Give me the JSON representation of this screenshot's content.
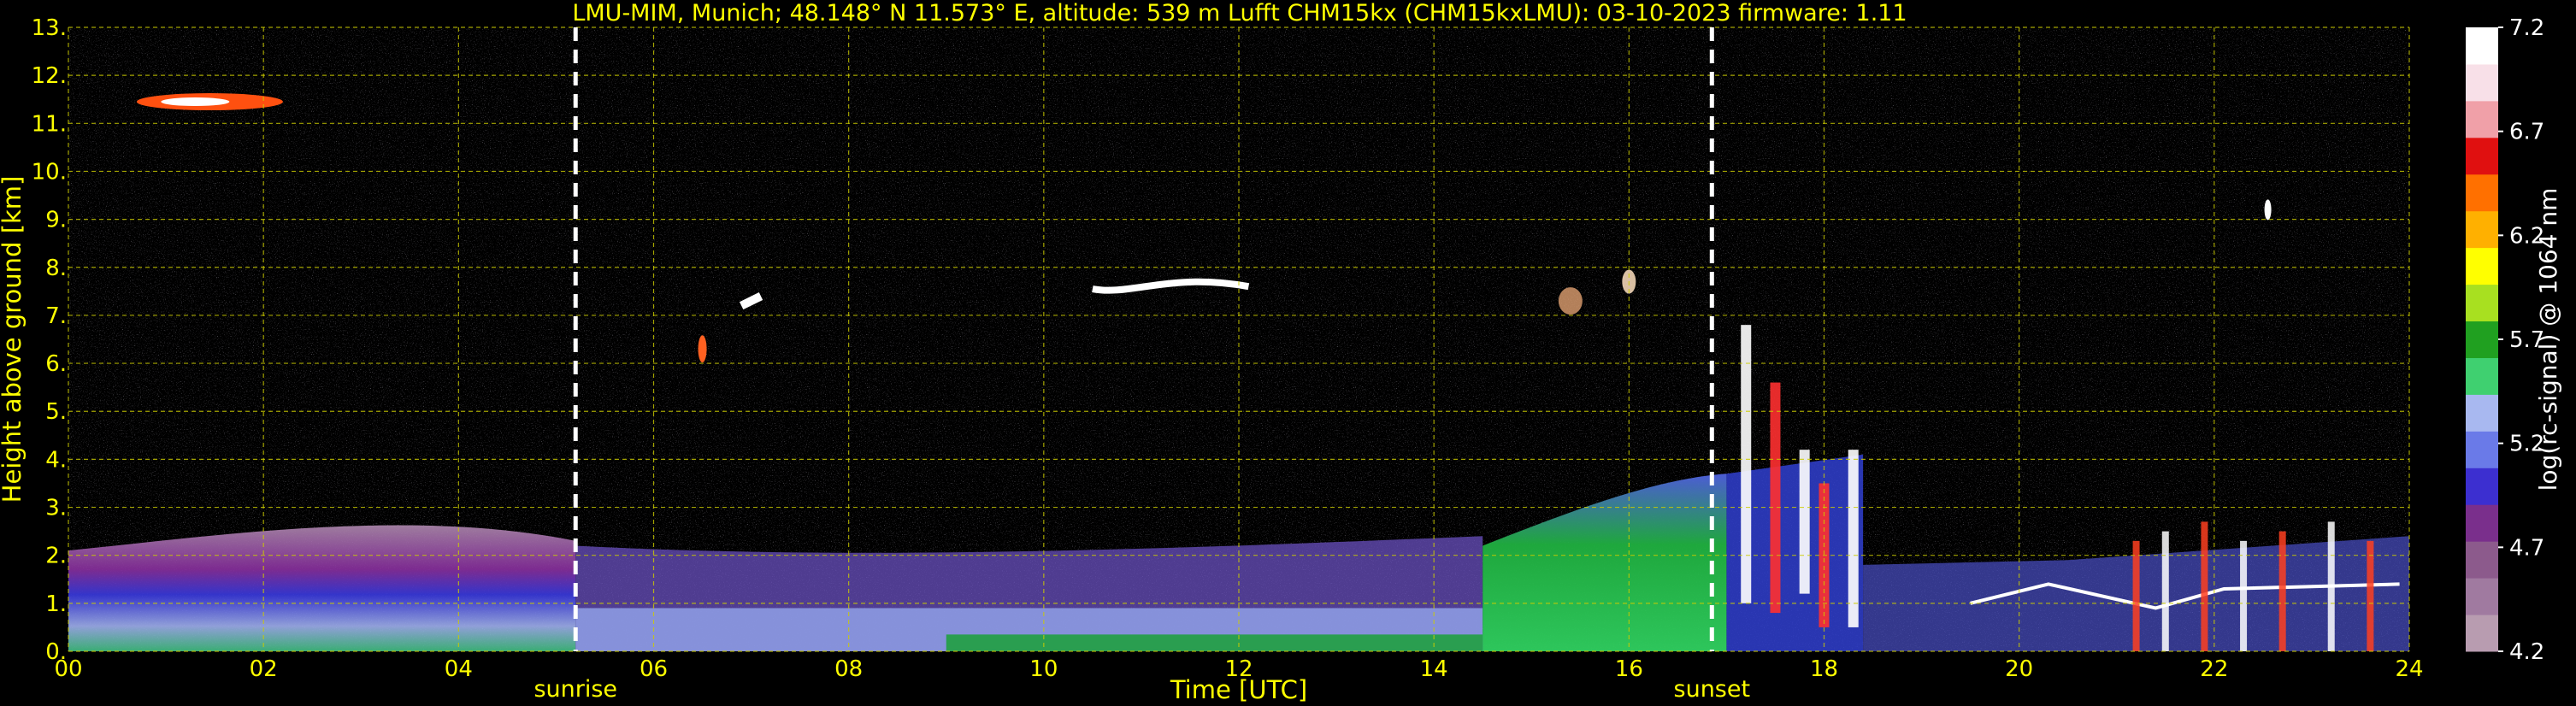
{
  "chart_data": {
    "type": "heatmap",
    "title": "LMU-MIM, Munich; 48.148° N 11.573° E, altitude: 539 m    Lufft CHM15kx (CHM15kxLMU): 03-10-2023    firmware: 1.11",
    "xlabel": "Time [UTC]",
    "ylabel": "Height above ground [km]",
    "xlim": [
      0,
      24
    ],
    "ylim": [
      0,
      13
    ],
    "x_ticks": [
      "00",
      "02",
      "04",
      "06",
      "08",
      "10",
      "12",
      "14",
      "16",
      "18",
      "20",
      "22",
      "24"
    ],
    "y_ticks": [
      "0.",
      "1.",
      "2.",
      "3.",
      "4.",
      "5.",
      "6.",
      "7.",
      "8.",
      "9.",
      "10.",
      "11.",
      "12.",
      "13."
    ],
    "grid": true,
    "events": [
      {
        "label": "sunrise",
        "time": 5.2
      },
      {
        "label": "sunset",
        "time": 16.85
      }
    ],
    "colorbar": {
      "label": "log(rc-signal) @ 1064 nm",
      "range": [
        4.2,
        7.2
      ],
      "ticks": [
        "4.2",
        "4.7",
        "5.2",
        "5.7",
        "6.2",
        "6.7",
        "7.2"
      ]
    },
    "features": [
      {
        "description": "cirrus",
        "t_start": 0.7,
        "t_end": 2.2,
        "h_bottom": 11.2,
        "h_top": 11.8
      },
      {
        "description": "aerosol layer",
        "t_start": 0,
        "t_end": 5.2,
        "h_bottom": 0,
        "h_top": 2.1
      },
      {
        "description": "mid-level cloud",
        "t_start": 10.5,
        "t_end": 12.2,
        "h_bottom": 7.4,
        "h_top": 7.8
      }
    ]
  },
  "colors": {
    "background": "#000000",
    "text": "#ffff00",
    "grid": "#cccc00",
    "event_line": "#ffffff",
    "colormap": [
      "#b89cb0",
      "#a07aa0",
      "#8c5a8c",
      "#7a2f8c",
      "#3c2fd0",
      "#6a7ae8",
      "#a8b8f0",
      "#3fd070",
      "#20a020",
      "#a8e020",
      "#ffff00",
      "#ffb000",
      "#ff7000",
      "#e01010",
      "#f0a0a8",
      "#f8e0e8",
      "#ffffff"
    ]
  }
}
